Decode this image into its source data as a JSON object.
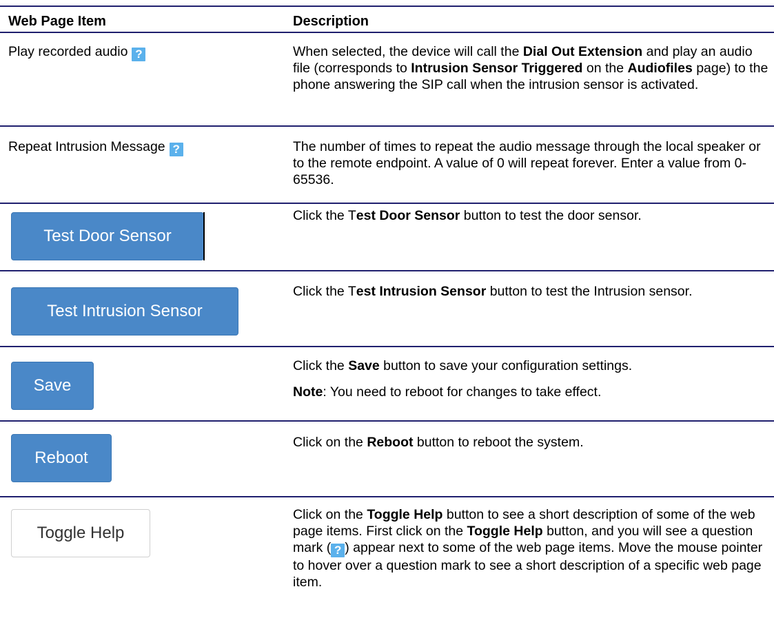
{
  "header": {
    "col1": "Web Page Item",
    "col2": "Description"
  },
  "help_icon_glyph": "?",
  "colors": {
    "rule": "#1f1f6e",
    "button_blue": "#4a88c8",
    "help_icon": "#5bb1ec"
  },
  "rows": [
    {
      "item": "Play recorded audio",
      "desc": [
        {
          "t": "When selected, the device will call the "
        },
        {
          "b": "Dial Out Extension"
        },
        {
          "t": " and play an audio file (corresponds to "
        },
        {
          "b": "Intrusion Sensor Triggered"
        },
        {
          "t": " on the "
        },
        {
          "b": "Audiofiles"
        },
        {
          "t": " page) to the phone answering the SIP call when the intrusion sensor is activated."
        }
      ]
    },
    {
      "item": "Repeat Intrusion Message",
      "desc": [
        {
          "t": "The number of times to repeat the audio message through the local speaker or to the remote endpoint. A value of 0 will repeat forever. Enter a value from 0-65536."
        }
      ]
    },
    {
      "button": "Test Door Sensor",
      "desc": [
        {
          "t": "Click the T"
        },
        {
          "b": "est Door Sensor"
        },
        {
          "t": " button to test the door sensor."
        }
      ]
    },
    {
      "button": "Test Intrusion Sensor",
      "desc": [
        {
          "t": "Click the T"
        },
        {
          "b": "est Intrusion Sensor"
        },
        {
          "t": " button to test the Intrusion sensor."
        }
      ]
    },
    {
      "button": "Save",
      "desc": [
        {
          "t": "Click the "
        },
        {
          "b": "Save"
        },
        {
          "t": " button to save your configuration settings."
        }
      ],
      "note_label": "Note",
      "note_text": ": You need to reboot for changes to take effect."
    },
    {
      "button": "Reboot",
      "desc": [
        {
          "t": "Click on the "
        },
        {
          "b": "Reboot"
        },
        {
          "t": " button to reboot the system."
        }
      ]
    },
    {
      "button": "Toggle Help",
      "desc": [
        {
          "t": "Click on the "
        },
        {
          "b": "Toggle Help"
        },
        {
          "t": " button to see a short description of some of the web page items. First click on the "
        },
        {
          "b": "Toggle Help"
        },
        {
          "t": " button, and you will see a question mark ("
        },
        {
          "icon": "help"
        },
        {
          "t": ") appear next to some of the web page items. Move the mouse pointer to hover over a question mark to see a short description of a specific web page item."
        }
      ]
    }
  ]
}
